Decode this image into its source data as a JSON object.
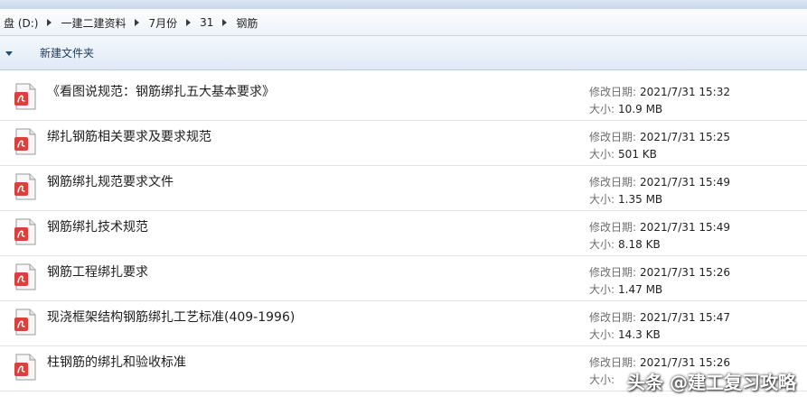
{
  "breadcrumb": [
    "盘 (D:)",
    "一建二建资料",
    "7月份",
    "31",
    "钢筋"
  ],
  "toolbar": {
    "new_folder": "新建文件夹"
  },
  "meta_labels": {
    "date": "修改日期:",
    "size": "大小:"
  },
  "files": [
    {
      "name": "《看图说规范：钢筋绑扎五大基本要求》",
      "date": "2021/7/31 15:32",
      "size": "10.9 MB"
    },
    {
      "name": "绑扎钢筋相关要求及要求规范",
      "date": "2021/7/31 15:25",
      "size": "501 KB"
    },
    {
      "name": "钢筋绑扎规范要求文件",
      "date": "2021/7/31 15:49",
      "size": "1.35 MB"
    },
    {
      "name": "钢筋绑扎技术规范",
      "date": "2021/7/31 15:49",
      "size": "8.18 KB"
    },
    {
      "name": "钢筋工程绑扎要求",
      "date": "2021/7/31 15:26",
      "size": "1.47 MB"
    },
    {
      "name": "现浇框架结构钢筋绑扎工艺标准(409-1996)",
      "date": "2021/7/31 15:47",
      "size": "14.3 KB"
    },
    {
      "name": "柱钢筋的绑扎和验收标准",
      "date": "2021/7/31 15:26",
      "size": ""
    }
  ],
  "watermark": "头条 @建工复习攻略",
  "colors": {
    "pdf_icon": "#d9423c",
    "accent": "#1e395b"
  }
}
